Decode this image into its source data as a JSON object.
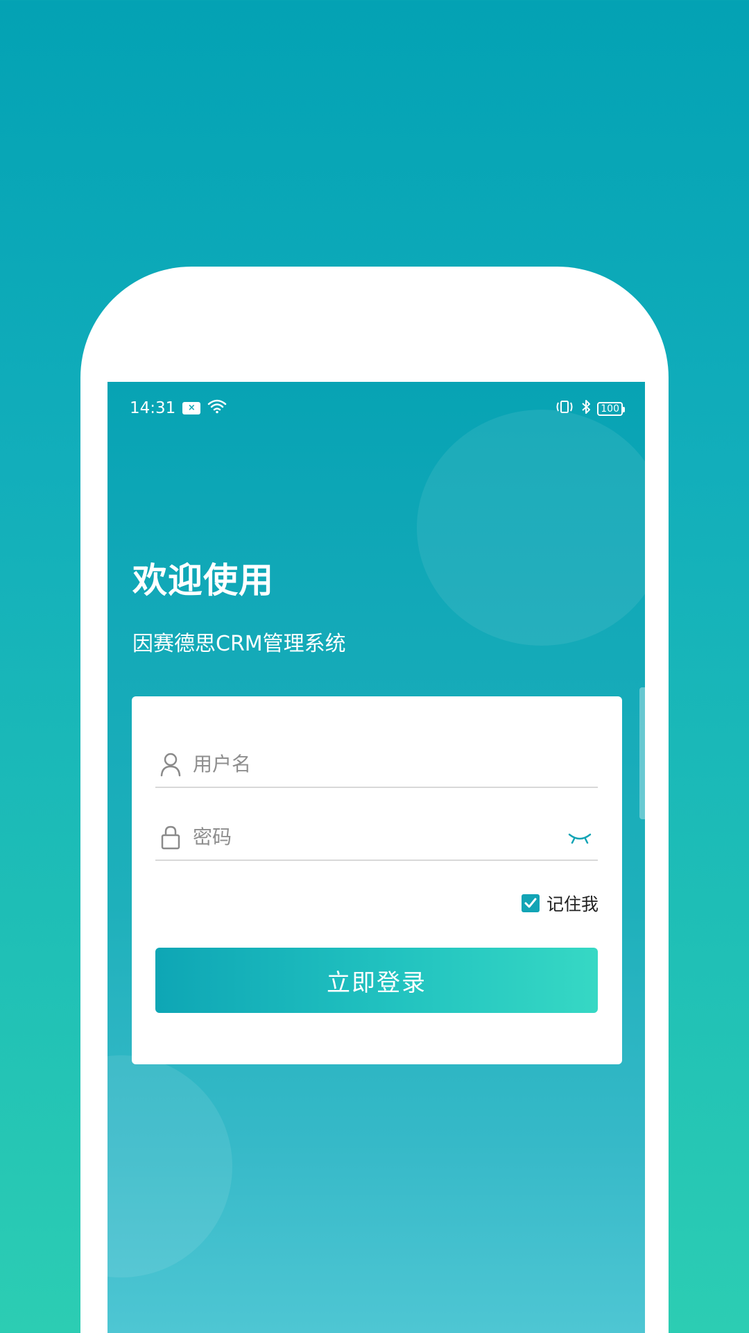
{
  "status_bar": {
    "time": "14:31",
    "sim_glyph": "×",
    "battery": "100",
    "left_icons": [
      "sim-icon",
      "wifi-icon"
    ],
    "right_icons": [
      "vibrate-icon",
      "bluetooth-icon",
      "battery-icon"
    ]
  },
  "header": {
    "title": "欢迎使用",
    "subtitle": "因赛德思CRM管理系统"
  },
  "form": {
    "username": {
      "placeholder": "用户名",
      "value": "",
      "icon": "user-icon"
    },
    "password": {
      "placeholder": "密码",
      "value": "",
      "icon": "lock-icon",
      "toggle_icon": "eye-closed-icon"
    },
    "remember": {
      "label": "记住我",
      "checked": true
    },
    "submit_label": "立即登录"
  },
  "colors": {
    "accent": "#12a4b5",
    "button_gradient_start": "#0ea6b5",
    "button_gradient_end": "#36d8c4",
    "background_top": "#03a2b4",
    "background_bottom": "#2ccdb3"
  }
}
